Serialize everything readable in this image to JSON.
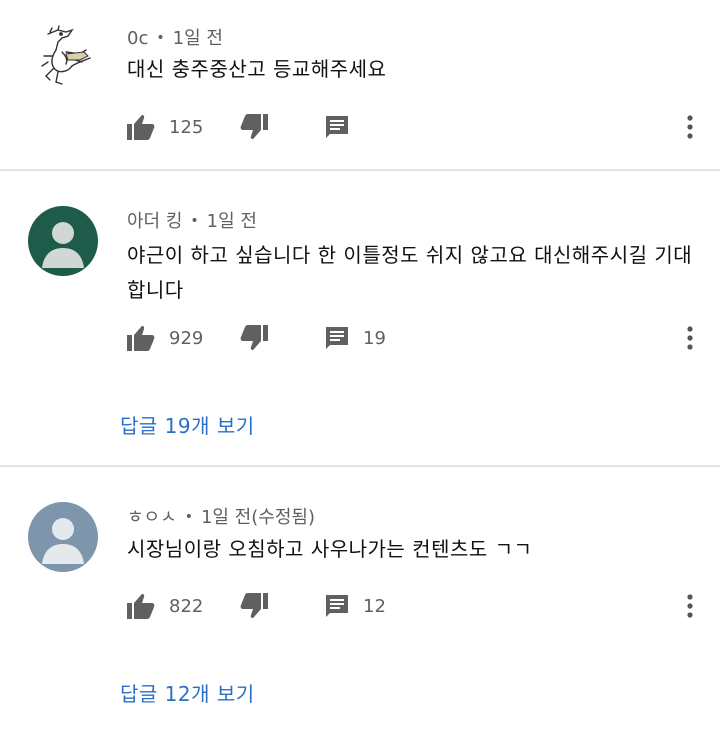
{
  "comments": [
    {
      "author": "0c",
      "dot": "•",
      "time": "1일 전",
      "text": "대신 충주중산고 등교해주세요",
      "likes": "125",
      "replies": "",
      "reply_link": ""
    },
    {
      "author": "아더 킹",
      "dot": "•",
      "time": "1일 전",
      "text": "야근이 하고 싶습니다 한 이틀정도 쉬지 않고요 대신해주시길 기대합니다",
      "likes": "929",
      "replies": "19",
      "reply_link": "답글 19개 보기",
      "avatar_color": "#1f5b4a"
    },
    {
      "author": "ㅎㅇㅅ",
      "dot": "•",
      "time": "1일 전(수정됨)",
      "text": "시장님이랑 오침하고 사우나가는 컨텐츠도 ㄱㄱ",
      "likes": "822",
      "replies": "12",
      "reply_link": "답글 12개 보기",
      "avatar_color": "#7e96ab"
    }
  ],
  "icons": {
    "like": "thumb-up-icon",
    "dislike": "thumb-down-icon",
    "reply": "comment-icon",
    "more": "more-vert-icon"
  },
  "colors": {
    "link": "#2a6fc7",
    "icon": "#606060",
    "divider": "#e2e2e2"
  }
}
